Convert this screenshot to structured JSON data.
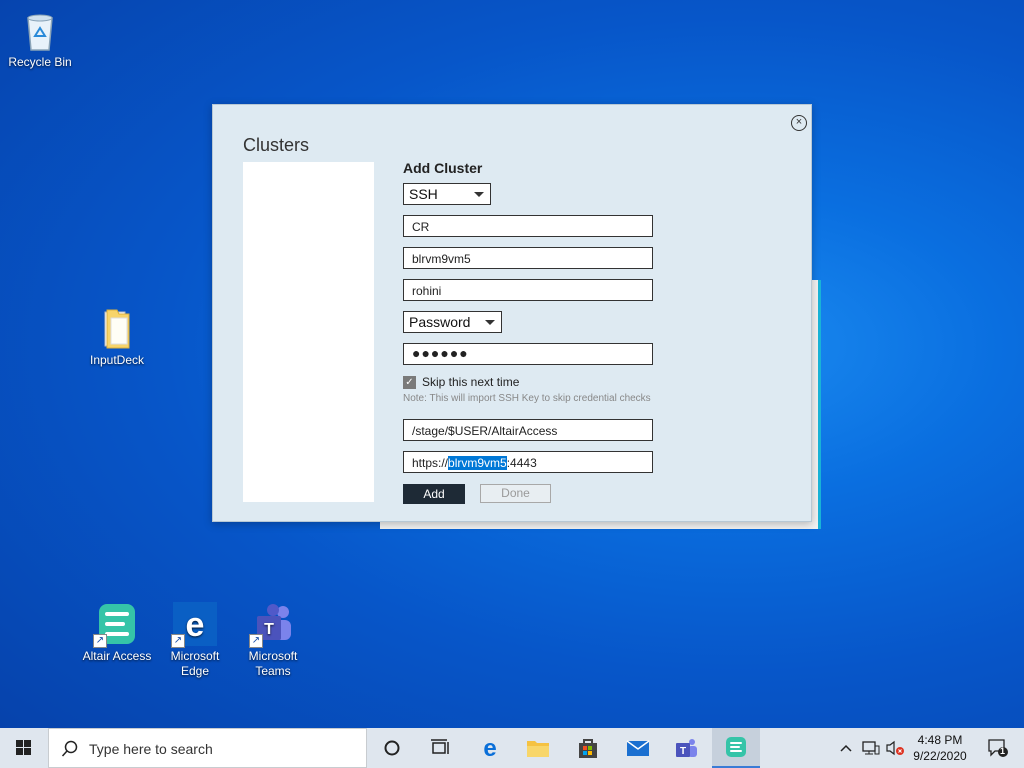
{
  "desktop": {
    "icons": {
      "recycle_bin": "Recycle Bin",
      "input_deck": "InputDeck",
      "altair_access": "Altair Access",
      "edge_line1": "Microsoft",
      "edge_line2": "Edge",
      "teams_line1": "Microsoft",
      "teams_line2": "Teams"
    }
  },
  "dialog": {
    "title": "Clusters",
    "close_icon": "×",
    "form": {
      "heading": "Add Cluster",
      "connection_type": "SSH",
      "name": "CR",
      "host": "blrvm9vm5",
      "user": "rohini",
      "auth_type": "Password",
      "password_mask": "●●●●●●",
      "skip_checked": "✓",
      "skip_label": "Skip this next time",
      "note": "Note: This will import SSH Key to skip credential checks",
      "stage_path": "/stage/$USER/AltairAccess",
      "url_prefix": "https://",
      "url_selected": "blrvm9vm5",
      "url_suffix": ":4443",
      "add_button": "Add",
      "done_button": "Done"
    }
  },
  "taskbar": {
    "search_placeholder": "Type here to search",
    "clock_time": "4:48 PM",
    "clock_date": "9/22/2020",
    "notification_count": "1"
  }
}
